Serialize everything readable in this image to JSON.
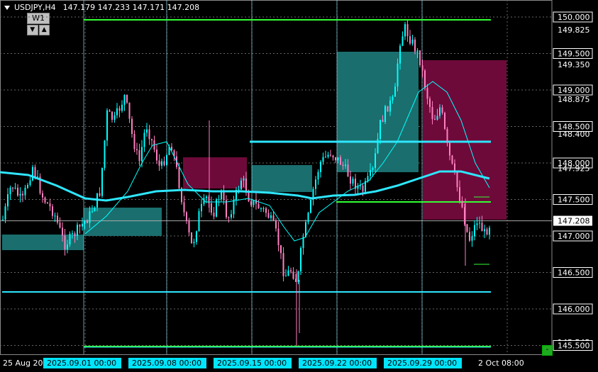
{
  "header": {
    "symbol_tf": "USDJPY,H4",
    "ohlc": "147.179 147.233 147.171 147.208"
  },
  "timeframe_box": {
    "label": "W1",
    "down": "▼",
    "up": "▲"
  },
  "price_axis": {
    "labels": [
      "150.000",
      "149.825",
      "149.500",
      "149.350",
      "149.000",
      "148.875",
      "148.500",
      "148.400",
      "148.000",
      "147.925",
      "147.500",
      "147.000",
      "146.500",
      "146.000",
      "145.545",
      "145.500"
    ],
    "boxed": [
      "150.000",
      "149.500",
      "149.000",
      "148.500",
      "148.000",
      "147.500",
      "147.000",
      "146.500",
      "146.000",
      "145.500"
    ],
    "current_price": "147.208"
  },
  "time_axis": {
    "plain": [
      {
        "text": "25 Aug 20"
      },
      {
        "text": "2 Oct 08:00"
      }
    ],
    "highlighted": [
      "2025.09.01 00:00",
      "2025.09.08 00:00",
      "2025.09.15 00:00",
      "2025.09.22 00:00",
      "2025.09.29 00:00"
    ]
  },
  "colors": {
    "bull": "#00ffff",
    "bear": "#ff80c0",
    "teal_zone": "#1a6e6e",
    "maroon_zone": "#6e0a3a",
    "green_line": "#33ff33",
    "cyan_line": "#2ee6ff",
    "grid": "#666666",
    "vline": "#8fd8e8"
  },
  "scale_button": "-"
}
